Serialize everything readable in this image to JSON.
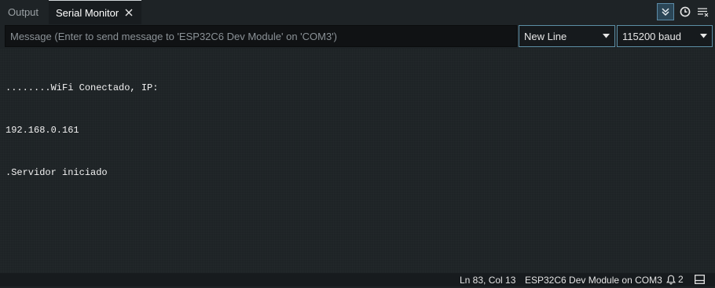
{
  "tabs": {
    "output_label": "Output",
    "serial_label": "Serial Monitor",
    "close_icon": "close-icon"
  },
  "toolbar": {
    "autoscroll_icon": "double-chevron-down-icon",
    "timestamp_icon": "clock-icon",
    "clear_icon": "clear-output-icon",
    "accent_color": "#5b8aa6"
  },
  "message": {
    "placeholder": "Message (Enter to send message to 'ESP32C6 Dev Module' on 'COM3')",
    "value": ""
  },
  "line_ending": {
    "selected": "New Line"
  },
  "baud_rate": {
    "selected": "115200 baud"
  },
  "output": {
    "lines": [
      "........WiFi Conectado, IP:",
      "192.168.0.161",
      ".Servidor iniciado"
    ]
  },
  "status": {
    "cursor": "Ln 83, Col 13",
    "board": "ESP32C6 Dev Module on COM3",
    "notifications": "2",
    "bell_icon": "bell-icon",
    "panel_icon": "toggle-panel-icon"
  }
}
